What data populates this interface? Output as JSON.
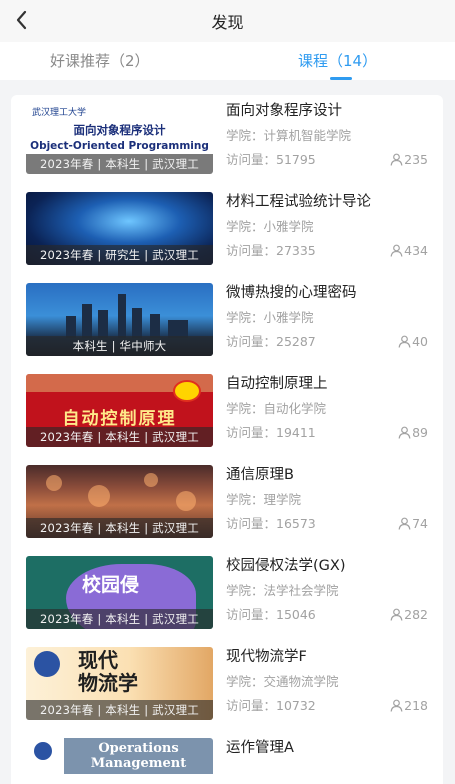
{
  "nav": {
    "title": "发现"
  },
  "tabs": [
    {
      "label": "好课推荐（2）"
    },
    {
      "label": "课程（14）"
    }
  ],
  "courses": [
    {
      "title": "面向对象程序设计",
      "college": "学院：计算机智能学院",
      "visits": "访问量：51795",
      "learners": "235",
      "thumb_caption": "2023年春 | 本科生 | 武汉理工",
      "thumb_cn": "面向对象程序设计",
      "thumb_en": "Object-Oriented Programming",
      "thumb_logo": "武汉理工大学"
    },
    {
      "title": "材料工程试验统计导论",
      "college": "学院：小雅学院",
      "visits": "访问量：27335",
      "learners": "434",
      "thumb_caption": "2023年春 | 研究生 | 武汉理工"
    },
    {
      "title": "微博热搜的心理密码",
      "college": "学院：小雅学院",
      "visits": "访问量：25287",
      "learners": "40",
      "thumb_caption": "本科生 | 华中师大"
    },
    {
      "title": "自动控制原理上",
      "college": "学院：自动化学院",
      "visits": "访问量：19411",
      "learners": "89",
      "thumb_caption": "2023年春 | 本科生 | 武汉理工",
      "thumb_big": "自动控制原理"
    },
    {
      "title": "通信原理B",
      "college": "学院：理学院",
      "visits": "访问量：16573",
      "learners": "74",
      "thumb_caption": "2023年春 | 本科生 | 武汉理工"
    },
    {
      "title": "校园侵权法学(GX)",
      "college": "学院：法学社会学院",
      "visits": "访问量：15046",
      "learners": "282",
      "thumb_caption": "2023年春 | 本科生 | 武汉理工",
      "thumb_big": "校园侵"
    },
    {
      "title": "现代物流学F",
      "college": "学院：交通物流学院",
      "visits": "访问量：10732",
      "learners": "218",
      "thumb_caption": "2023年春 | 本科生 | 武汉理工",
      "thumb_big1": "现代",
      "thumb_big2": "物流学"
    },
    {
      "title": "运作管理A",
      "college": "",
      "visits": "",
      "learners": "",
      "thumb_op1": "Operations",
      "thumb_op2": "Management"
    }
  ],
  "colors": {
    "accent": "#2f9bf0",
    "muted": "#a2a2a2",
    "background": "#f3f4f6"
  },
  "icons": {
    "back": "chevron-left-icon",
    "learners": "person-icon"
  }
}
